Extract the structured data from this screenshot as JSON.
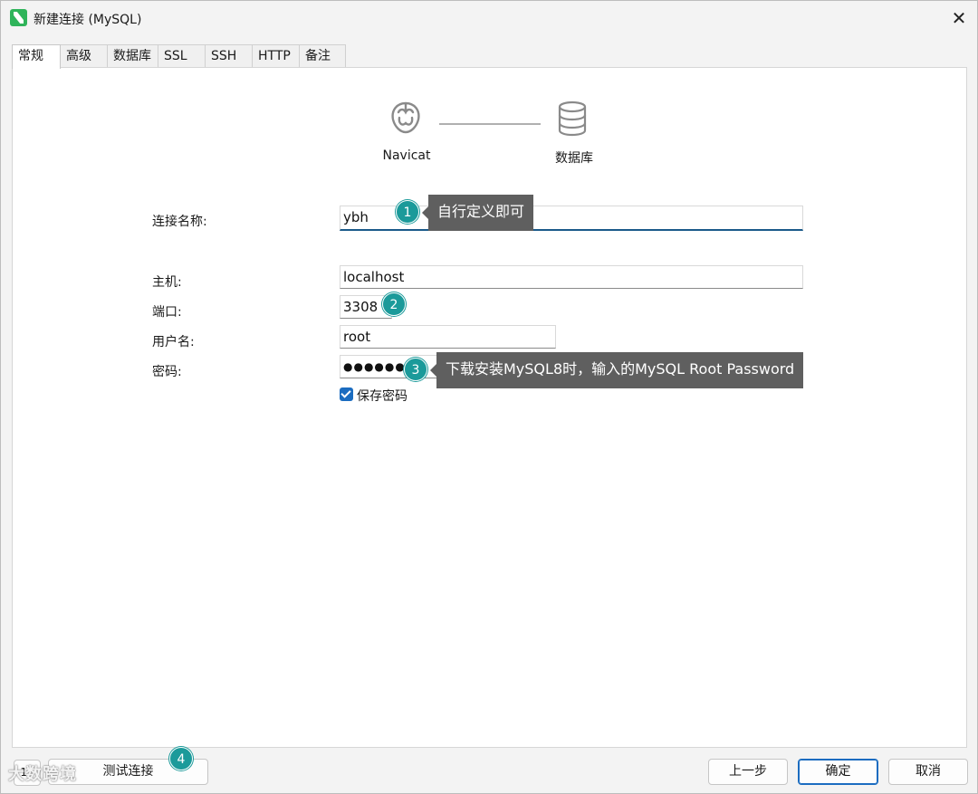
{
  "window": {
    "title": "新建连接 (MySQL)",
    "close_glyph": "✕"
  },
  "tabs": [
    {
      "label": "常规",
      "active": true
    },
    {
      "label": "高级"
    },
    {
      "label": "数据库"
    },
    {
      "label": "SSL"
    },
    {
      "label": "SSH"
    },
    {
      "label": "HTTP"
    },
    {
      "label": "备注"
    }
  ],
  "header": {
    "left_label": "Navicat",
    "right_label": "数据库",
    "left_icon": "navicat-logo-icon",
    "right_icon": "database-icon"
  },
  "form": {
    "connection_name_label": "连接名称:",
    "connection_name_value": "ybh",
    "host_label": "主机:",
    "host_value": "localhost",
    "port_label": "端口:",
    "port_value": "3308",
    "username_label": "用户名:",
    "username_value": "root",
    "password_label": "密码:",
    "password_value": "●●●●●●●",
    "save_password_label": "保存密码",
    "save_password_checked": true
  },
  "annotations": [
    {
      "number": "1",
      "text": "自行定义即可"
    },
    {
      "number": "2",
      "text": ""
    },
    {
      "number": "3",
      "text": "下载安装MySQL8时，输入的MySQL Root Password"
    },
    {
      "number": "4",
      "text": ""
    }
  ],
  "footer": {
    "left_small_label": "11",
    "test_connection_label": "测试连接",
    "prev_label": "上一步",
    "ok_label": "确定",
    "cancel_label": "取消",
    "watermark": "大数跨境"
  },
  "colors": {
    "accent": "#1b6cc0",
    "badge": "#1b9a9a",
    "tooltip_bg": "#5f5f5f",
    "app_icon": "#2fb45a"
  }
}
